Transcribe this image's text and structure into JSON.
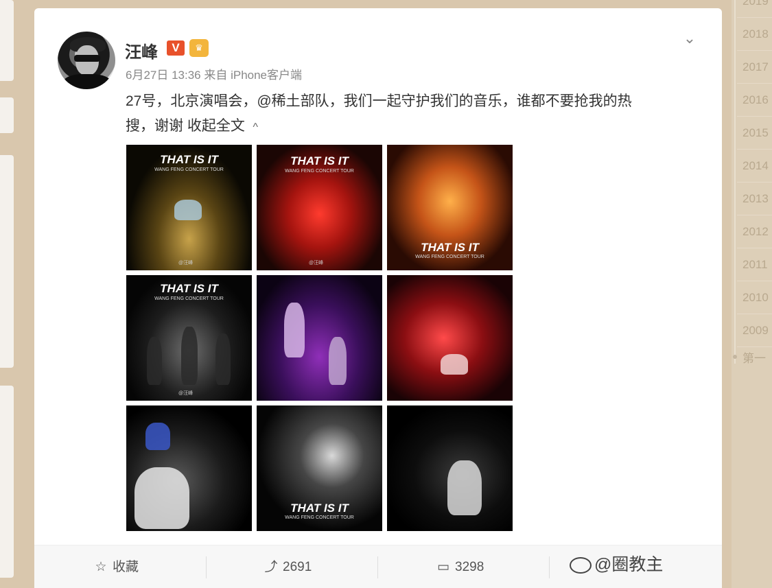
{
  "post": {
    "author": "汪峰",
    "verified_badge": "V",
    "member_badge_icon": "crown-badge-icon",
    "meta": "6月27日 13:36 来自 iPhone客户端",
    "text_line1": "27号，北京演唱会，@稀土部队，我们一起守护我们的音乐，谁都不要抢我的热",
    "text_line2_prefix": "搜，谢谢 ",
    "collapse_label": "收起全文",
    "collapse_icon": "^",
    "images": [
      {
        "title": "THAT IS IT",
        "subtitle": "WANG FENG CONCERT TOUR"
      },
      {
        "title": "THAT IS IT",
        "subtitle": "WANG FENG CONCERT TOUR"
      },
      {
        "title": "THAT IS IT",
        "subtitle": "WANG FENG CONCERT TOUR"
      },
      {
        "title": "THAT IS IT",
        "subtitle": "WANG FENG CONCERT TOUR"
      },
      {
        "title": "",
        "subtitle": ""
      },
      {
        "title": "",
        "subtitle": ""
      },
      {
        "title": "",
        "subtitle": ""
      },
      {
        "title": "THAT IS IT",
        "subtitle": "WANG FENG CONCERT TOUR"
      },
      {
        "title": "",
        "subtitle": ""
      }
    ],
    "image_watermark": "@汪峰"
  },
  "actions": {
    "favorite_label": "收藏",
    "repost_count": "2691",
    "comment_count": "3298"
  },
  "watermark": "@圈教主",
  "timeline": {
    "years": [
      "2019",
      "2018",
      "2017",
      "2016",
      "2015",
      "2014",
      "2013",
      "2012",
      "2011",
      "2010",
      "2009"
    ],
    "more": "第一"
  },
  "colors": {
    "background": "#d9c7ad",
    "verified": "#e8512b",
    "member": "#f3b53c"
  }
}
